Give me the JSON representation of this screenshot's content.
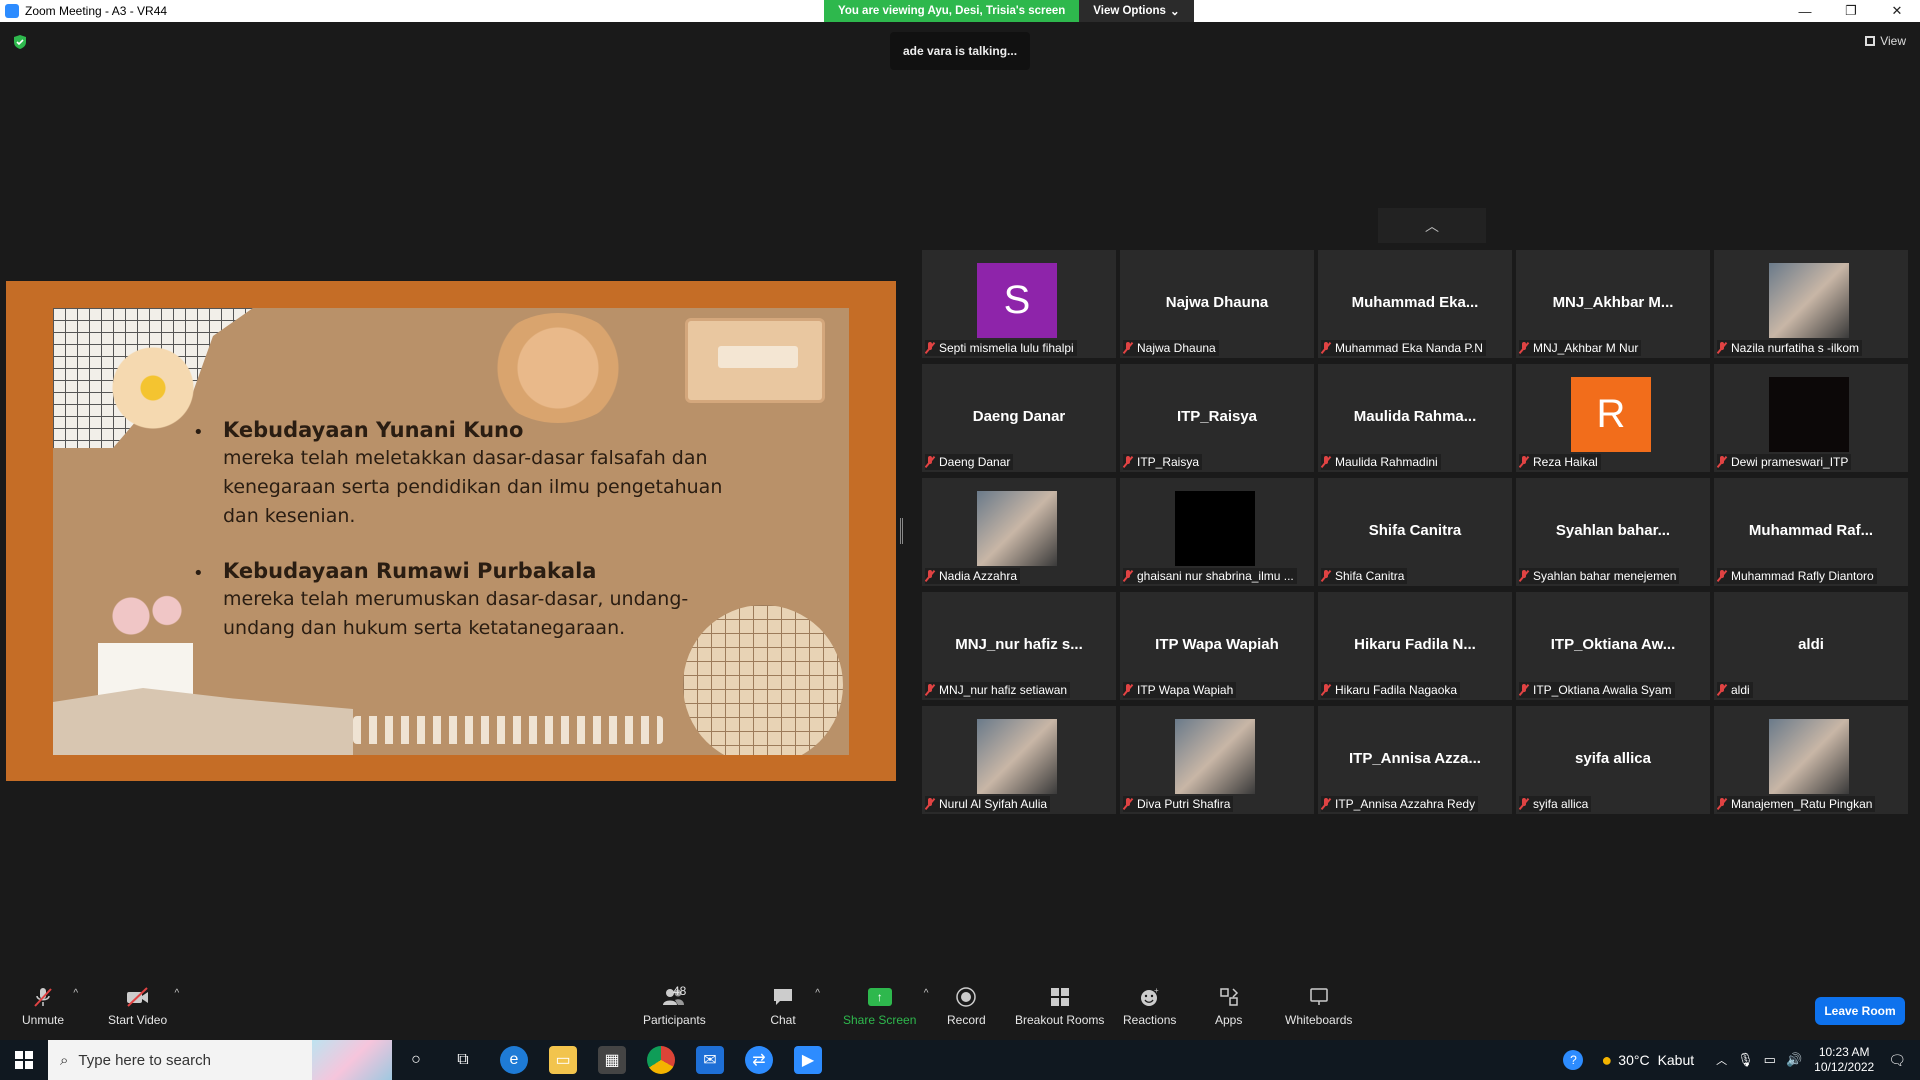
{
  "window": {
    "title": "Zoom Meeting - A3 - VR44",
    "viewing_banner": "You are viewing Ayu, Desi, Trisia's screen",
    "view_options": "View Options",
    "minimize": "—",
    "restore": "❐",
    "close": "✕"
  },
  "talking_indicator": "ade vara is talking...",
  "view_button": "View",
  "page_up": "︿",
  "slide": {
    "bullets": [
      {
        "title": "Kebudayaan Yunani Kuno",
        "body": "mereka telah meletakkan dasar-dasar falsafah dan kenegaraan serta pendidikan dan ilmu pengetahuan dan kesenian."
      },
      {
        "title": "Kebudayaan Rumawi Purbakala",
        "body": "mereka telah merumuskan dasar-dasar, undang-undang dan hukum serta ketatanegaraan."
      }
    ],
    "bullet_char": "•"
  },
  "participants": [
    {
      "center": "",
      "label": "Septi mismelia lulu fihalpi",
      "avatar_letter": "S",
      "avatar_color": "#8e24aa",
      "type": "letter"
    },
    {
      "center": "Najwa Dhauna",
      "label": "Najwa Dhauna",
      "type": "name"
    },
    {
      "center": "Muhammad  Eka...",
      "label": "Muhammad Eka Nanda P.N",
      "type": "name"
    },
    {
      "center": "MNJ_Akhbar  M...",
      "label": "MNJ_Akhbar M Nur",
      "type": "name"
    },
    {
      "center": "",
      "label": "Nazila nurfatiha s -ilkom",
      "type": "photo"
    },
    {
      "center": "Daeng Danar",
      "label": "Daeng Danar",
      "type": "name"
    },
    {
      "center": "ITP_Raisya",
      "label": "ITP_Raisya",
      "type": "name"
    },
    {
      "center": "Maulida  Rahma...",
      "label": "Maulida Rahmadini",
      "type": "name"
    },
    {
      "center": "",
      "label": "Reza Haikal",
      "avatar_letter": "R",
      "avatar_color": "#f26d1b",
      "type": "letter"
    },
    {
      "center": "",
      "label": "Dewi prameswari_ITP",
      "type": "dark"
    },
    {
      "center": "",
      "label": "Nadia Azzahra",
      "type": "photo"
    },
    {
      "center": "",
      "label": "ghaisani nur shabrina_ilmu ...",
      "type": "black"
    },
    {
      "center": "Shifa Canitra",
      "label": "Shifa Canitra",
      "type": "name"
    },
    {
      "center": "Syahlan  bahar...",
      "label": "Syahlan bahar menejemen",
      "type": "name"
    },
    {
      "center": "Muhammad  Raf...",
      "label": "Muhammad Rafly Diantoro",
      "type": "name"
    },
    {
      "center": "MNJ_nur  hafiz  s...",
      "label": "MNJ_nur hafiz setiawan",
      "type": "name"
    },
    {
      "center": "ITP Wapa Wapiah",
      "label": "ITP Wapa Wapiah",
      "type": "name"
    },
    {
      "center": "Hikaru  Fadila  N...",
      "label": "Hikaru Fadila Nagaoka",
      "type": "name"
    },
    {
      "center": "ITP_Oktiana  Aw...",
      "label": "ITP_Oktiana Awalia Syam",
      "type": "name"
    },
    {
      "center": "aldi",
      "label": "aldi",
      "type": "name"
    },
    {
      "center": "",
      "label": "Nurul Al Syifah Aulia",
      "type": "photo"
    },
    {
      "center": "",
      "label": "Diva Putri Shafira",
      "type": "photo"
    },
    {
      "center": "ITP_Annisa  Azza...",
      "label": "ITP_Annisa Azzahra Redy",
      "type": "name"
    },
    {
      "center": "syifa allica",
      "label": "syifa allica",
      "type": "name"
    },
    {
      "center": "",
      "label": "Manajemen_Ratu Pingkan",
      "type": "photo"
    }
  ],
  "toolbar": {
    "unmute": "Unmute",
    "start_video": "Start Video",
    "participants": "Participants",
    "participants_count": "48",
    "chat": "Chat",
    "share_screen": "Share Screen",
    "record": "Record",
    "breakout_rooms": "Breakout Rooms",
    "reactions": "Reactions",
    "apps": "Apps",
    "whiteboards": "Whiteboards",
    "leave_room": "Leave Room"
  },
  "taskbar": {
    "search_placeholder": "Type here to search",
    "weather_temp": "30°C",
    "weather_desc": "Kabut",
    "time": "10:23 AM",
    "date": "10/12/2022"
  },
  "colors": {
    "accent_green": "#2eb84d",
    "leave_blue": "#0e72ed",
    "share_border": "#c56d26",
    "muted_red": "#e04343"
  }
}
